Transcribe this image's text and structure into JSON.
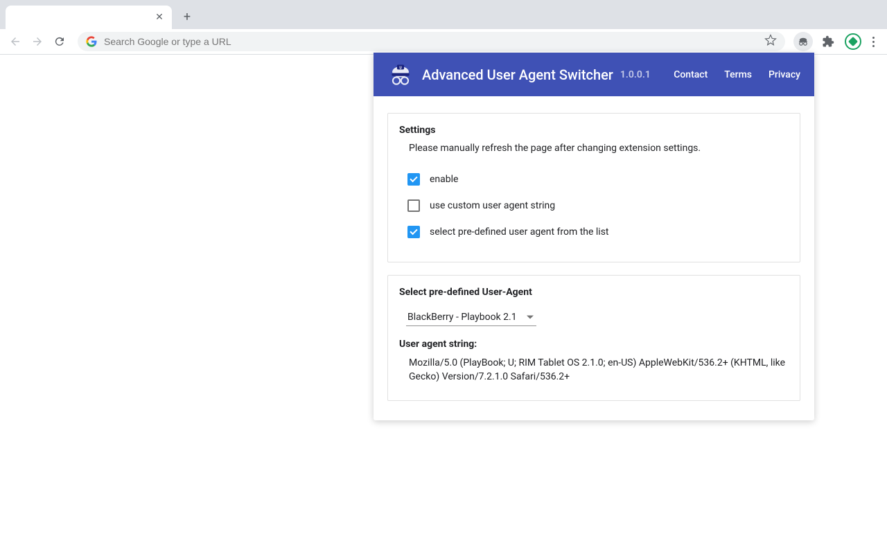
{
  "browser": {
    "tab_title": "",
    "omnibox_placeholder": "Search Google or type a URL"
  },
  "popup": {
    "title": "Advanced User Agent Switcher",
    "version": "1.0.0.1",
    "nav": {
      "contact": "Contact",
      "terms": "Terms",
      "privacy": "Privacy"
    },
    "settings": {
      "heading": "Settings",
      "note": "Please manually refresh the page after changing extension settings.",
      "options": {
        "enable": {
          "label": "enable",
          "checked": true
        },
        "custom": {
          "label": "use custom user agent string",
          "checked": false
        },
        "predefined": {
          "label": "select pre-defined user agent from the list",
          "checked": true
        }
      }
    },
    "predefined": {
      "heading": "Select pre-defined User-Agent",
      "selected": "BlackBerry - Playbook 2.1",
      "ua_label": "User agent string:",
      "ua_string": "Mozilla/5.0 (PlayBook; U; RIM Tablet OS 2.1.0; en-US) AppleWebKit/536.2+ (KHTML, like Gecko) Version/7.2.1.0 Safari/536.2+"
    }
  }
}
